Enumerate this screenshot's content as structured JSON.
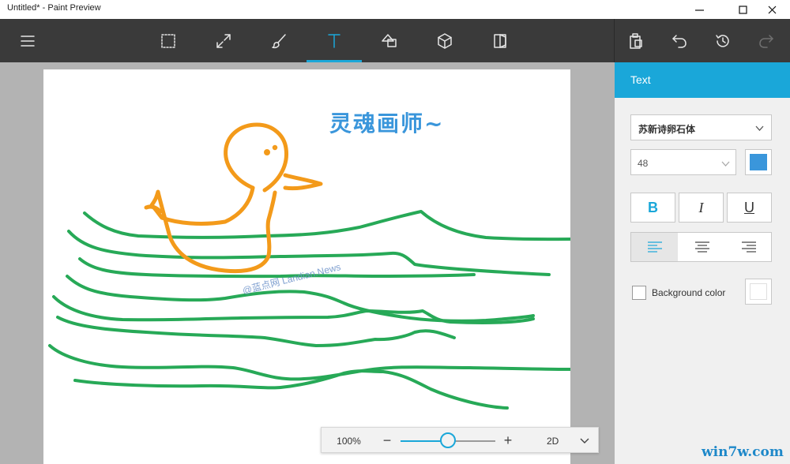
{
  "window": {
    "title": "Untitled* - Paint Preview"
  },
  "toolbar": {
    "tools": [
      {
        "name": "menu-icon"
      },
      {
        "name": "select-icon"
      },
      {
        "name": "crop-icon"
      },
      {
        "name": "brush-icon"
      },
      {
        "name": "text-icon",
        "active": true
      },
      {
        "name": "2d-shapes-icon"
      },
      {
        "name": "3d-shapes-icon"
      },
      {
        "name": "stickers-icon"
      }
    ],
    "actions": [
      "paste-icon",
      "undo-icon",
      "history-icon",
      "redo-icon"
    ]
  },
  "canvas": {
    "text": "灵魂画师~",
    "watermark": "@蓝点网 Landian.News",
    "colors": {
      "duck": "#f39a1a",
      "waves": "#27a957",
      "text": "#3a96db"
    }
  },
  "zoom": {
    "level": "100%",
    "minus": "−",
    "plus": "+",
    "slider_fraction": 0.5,
    "mode": "2D"
  },
  "panel": {
    "title": "Text",
    "font": "苏新诗卵石体",
    "size": "48",
    "text_color": "#3a96db",
    "bold_label": "B",
    "italic_label": "I",
    "underline_label": "U",
    "alignment": "left",
    "background_color_label": "Background color",
    "background_checked": false,
    "background_color": "#ffffff"
  },
  "site_watermark": "win7w.com"
}
